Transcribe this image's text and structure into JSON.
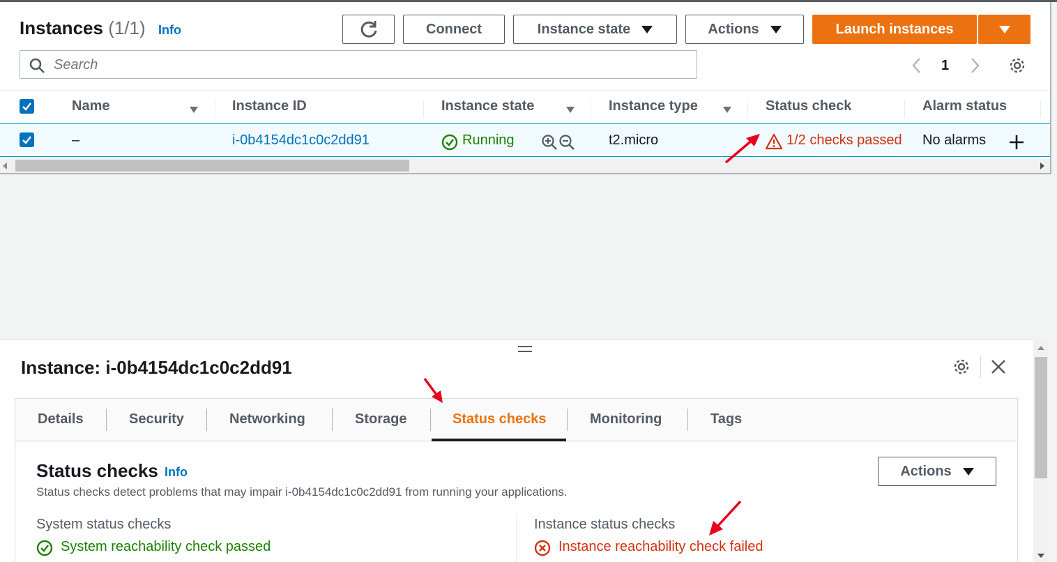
{
  "header": {
    "title": "Instances",
    "count": "(1/1)",
    "info": "Info"
  },
  "toolbar": {
    "connect": "Connect",
    "instance_state": "Instance state",
    "actions": "Actions",
    "launch": "Launch instances"
  },
  "search": {
    "placeholder": "Search"
  },
  "pagination": {
    "page": "1"
  },
  "table": {
    "headers": {
      "name": "Name",
      "instance_id": "Instance ID",
      "instance_state": "Instance state",
      "instance_type": "Instance type",
      "status_check": "Status check",
      "alarm_status": "Alarm status"
    },
    "row": {
      "name": "–",
      "instance_id": "i-0b4154dc1c0c2dd91",
      "instance_state": "Running",
      "instance_type": "t2.micro",
      "status_check": "1/2 checks passed",
      "alarm_status": "No alarms"
    }
  },
  "detail": {
    "title": "Instance: i-0b4154dc1c0c2dd91",
    "tabs": [
      "Details",
      "Security",
      "Networking",
      "Storage",
      "Status checks",
      "Monitoring",
      "Tags"
    ],
    "active_tab": "Status checks",
    "section_title": "Status checks",
    "info": "Info",
    "description": "Status checks detect problems that may impair i-0b4154dc1c0c2dd91 from running your applications.",
    "actions": "Actions",
    "system": {
      "heading": "System status checks",
      "result": "System reachability check passed"
    },
    "instance": {
      "heading": "Instance status checks",
      "result": "Instance reachability check failed"
    }
  },
  "colors": {
    "primary": "#ec7211",
    "link": "#0073bb",
    "success": "#1d8102",
    "error": "#d13212",
    "selected_row": "#f1faff",
    "annotation": "#e8001c"
  }
}
